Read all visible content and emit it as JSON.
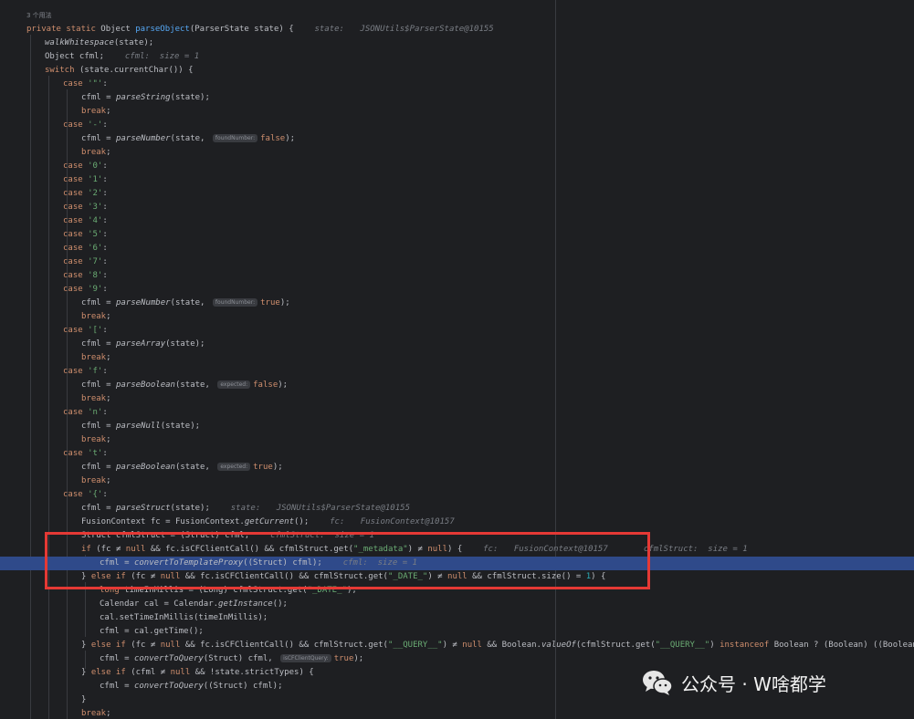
{
  "editor": {
    "usages_label": "3 个用法",
    "lines": [
      [
        [
          "private static ",
          "kw"
        ],
        [
          "Object ",
          ""
        ],
        [
          "parseObject",
          "fn"
        ],
        [
          "(ParserState state) {",
          ""
        ],
        [
          "  state: ",
          "inlay"
        ],
        [
          "JSONUtils$ParserState@10155",
          "inlay obj"
        ]
      ],
      [
        [
          "walkWhitespace",
          "it"
        ],
        [
          "(state);",
          ""
        ]
      ],
      [
        [
          "Object cfml;",
          ""
        ],
        [
          "  cfml:  size = 1",
          "inlay"
        ]
      ],
      [
        [
          "switch ",
          "kw"
        ],
        [
          "(state.currentChar()) {",
          ""
        ]
      ],
      [
        [
          "case ",
          "kw"
        ],
        [
          "'\"'",
          "str"
        ],
        [
          ":",
          ""
        ]
      ],
      [
        [
          "cfml = ",
          ""
        ],
        [
          "parseString",
          "it"
        ],
        [
          "(state);",
          ""
        ]
      ],
      [
        [
          "break",
          "kw"
        ],
        [
          ";",
          ""
        ]
      ],
      [
        [
          "case ",
          "kw"
        ],
        [
          "'-'",
          "str"
        ],
        [
          ":",
          ""
        ]
      ],
      [
        [
          "cfml = ",
          ""
        ],
        [
          "parseNumber",
          "it"
        ],
        [
          "(state, ",
          ""
        ],
        [
          "foundNumber:",
          "chip"
        ],
        [
          "false",
          "kw"
        ],
        [
          ");",
          ""
        ]
      ],
      [
        [
          "break",
          "kw"
        ],
        [
          ";",
          ""
        ]
      ],
      [
        [
          "case ",
          "kw"
        ],
        [
          "'0'",
          "str"
        ],
        [
          ":",
          ""
        ]
      ],
      [
        [
          "case ",
          "kw"
        ],
        [
          "'1'",
          "str"
        ],
        [
          ":",
          ""
        ]
      ],
      [
        [
          "case ",
          "kw"
        ],
        [
          "'2'",
          "str"
        ],
        [
          ":",
          ""
        ]
      ],
      [
        [
          "case ",
          "kw"
        ],
        [
          "'3'",
          "str"
        ],
        [
          ":",
          ""
        ]
      ],
      [
        [
          "case ",
          "kw"
        ],
        [
          "'4'",
          "str"
        ],
        [
          ":",
          ""
        ]
      ],
      [
        [
          "case ",
          "kw"
        ],
        [
          "'5'",
          "str"
        ],
        [
          ":",
          ""
        ]
      ],
      [
        [
          "case ",
          "kw"
        ],
        [
          "'6'",
          "str"
        ],
        [
          ":",
          ""
        ]
      ],
      [
        [
          "case ",
          "kw"
        ],
        [
          "'7'",
          "str"
        ],
        [
          ":",
          ""
        ]
      ],
      [
        [
          "case ",
          "kw"
        ],
        [
          "'8'",
          "str"
        ],
        [
          ":",
          ""
        ]
      ],
      [
        [
          "case ",
          "kw"
        ],
        [
          "'9'",
          "str"
        ],
        [
          ":",
          ""
        ]
      ],
      [
        [
          "cfml = ",
          ""
        ],
        [
          "parseNumber",
          "it"
        ],
        [
          "(state, ",
          ""
        ],
        [
          "foundNumber:",
          "chip"
        ],
        [
          "true",
          "kw"
        ],
        [
          ");",
          ""
        ]
      ],
      [
        [
          "break",
          "kw"
        ],
        [
          ";",
          ""
        ]
      ],
      [
        [
          "case ",
          "kw"
        ],
        [
          "'['",
          "str"
        ],
        [
          ":",
          ""
        ]
      ],
      [
        [
          "cfml = ",
          ""
        ],
        [
          "parseArray",
          "it"
        ],
        [
          "(state);",
          ""
        ]
      ],
      [
        [
          "break",
          "kw"
        ],
        [
          ";",
          ""
        ]
      ],
      [
        [
          "case ",
          "kw"
        ],
        [
          "'f'",
          "str"
        ],
        [
          ":",
          ""
        ]
      ],
      [
        [
          "cfml = ",
          ""
        ],
        [
          "parseBoolean",
          "it"
        ],
        [
          "(state, ",
          ""
        ],
        [
          "expected:",
          "chip"
        ],
        [
          "false",
          "kw"
        ],
        [
          ");",
          ""
        ]
      ],
      [
        [
          "break",
          "kw"
        ],
        [
          ";",
          ""
        ]
      ],
      [
        [
          "case ",
          "kw"
        ],
        [
          "'n'",
          "str"
        ],
        [
          ":",
          ""
        ]
      ],
      [
        [
          "cfml = ",
          ""
        ],
        [
          "parseNull",
          "it"
        ],
        [
          "(state);",
          ""
        ]
      ],
      [
        [
          "break",
          "kw"
        ],
        [
          ";",
          ""
        ]
      ],
      [
        [
          "case ",
          "kw"
        ],
        [
          "'t'",
          "str"
        ],
        [
          ":",
          ""
        ]
      ],
      [
        [
          "cfml = ",
          ""
        ],
        [
          "parseBoolean",
          "it"
        ],
        [
          "(state, ",
          ""
        ],
        [
          "expected:",
          "chip"
        ],
        [
          "true",
          "kw"
        ],
        [
          ");",
          ""
        ]
      ],
      [
        [
          "break",
          "kw"
        ],
        [
          ";",
          ""
        ]
      ],
      [
        [
          "case ",
          "kw"
        ],
        [
          "'{'",
          "str"
        ],
        [
          ":",
          ""
        ]
      ],
      [
        [
          "cfml = ",
          ""
        ],
        [
          "parseStruct",
          "it"
        ],
        [
          "(state);",
          ""
        ],
        [
          "  state: ",
          "inlay"
        ],
        [
          "JSONUtils$ParserState@10155",
          "inlay obj"
        ]
      ],
      [
        [
          "FusionContext fc = FusionContext.",
          ""
        ],
        [
          "getCurrent",
          "it"
        ],
        [
          "();",
          ""
        ],
        [
          "  fc: ",
          "inlay"
        ],
        [
          "FusionContext@10157",
          "inlay obj"
        ]
      ],
      [
        [
          "Struct cfmlStruct = (Struct) cfml;",
          ""
        ],
        [
          "  cfmlStruct:  size = 1",
          "inlay"
        ]
      ],
      [
        [
          "if ",
          "kw"
        ],
        [
          "(fc ≠ ",
          ""
        ],
        [
          "null ",
          "kw"
        ],
        [
          "&& fc.isCFClientCall() && cfmlStruct.get(",
          ""
        ],
        [
          "\"_metadata\"",
          "str"
        ],
        [
          ") ≠ ",
          ""
        ],
        [
          "null",
          "kw"
        ],
        [
          ") {",
          ""
        ],
        [
          "  fc: ",
          "inlay"
        ],
        [
          "FusionContext@10157",
          "inlay obj"
        ],
        [
          "     cfmlStruct:  size = 1",
          "inlay"
        ]
      ],
      [
        [
          "cfml = ",
          ""
        ],
        [
          "convertToTemplateProxy",
          "it"
        ],
        [
          "((Struct) cfml);",
          ""
        ],
        [
          "  cfml:  size = 1",
          "inlay"
        ]
      ],
      [
        [
          "} ",
          ""
        ],
        [
          "else if ",
          "kw"
        ],
        [
          "(fc ≠ ",
          ""
        ],
        [
          "null ",
          "kw"
        ],
        [
          "&& fc.isCFClientCall() && cfmlStruct.get(",
          ""
        ],
        [
          "\"_DATE_\"",
          "str"
        ],
        [
          ") ≠ ",
          ""
        ],
        [
          "null ",
          "kw"
        ],
        [
          "&& cfmlStruct.size() = ",
          ""
        ],
        [
          "1",
          "num"
        ],
        [
          ") {",
          ""
        ]
      ],
      [
        [
          "long ",
          "kw"
        ],
        [
          "timeInMillis = (Long) cfmlStruct.get(",
          ""
        ],
        [
          "\"_DATE_\"",
          "str"
        ],
        [
          ");",
          ""
        ]
      ],
      [
        [
          "Calendar cal = Calendar.",
          ""
        ],
        [
          "getInstance",
          "it"
        ],
        [
          "();",
          ""
        ]
      ],
      [
        [
          "cal.setTimeInMillis(timeInMillis);",
          ""
        ]
      ],
      [
        [
          "cfml = cal.getTime();",
          ""
        ]
      ],
      [
        [
          "} ",
          ""
        ],
        [
          "else if ",
          "kw"
        ],
        [
          "(fc ≠ ",
          ""
        ],
        [
          "null ",
          "kw"
        ],
        [
          "&& fc.isCFClientCall() && cfmlStruct.get(",
          ""
        ],
        [
          "\"__QUERY__\"",
          "str"
        ],
        [
          ") ≠ ",
          ""
        ],
        [
          "null ",
          "kw"
        ],
        [
          "&& Boolean.",
          ""
        ],
        [
          "valueOf",
          "it"
        ],
        [
          "(cfmlStruct.get(",
          ""
        ],
        [
          "\"__QUERY__\"",
          "str"
        ],
        [
          ") ",
          ""
        ],
        [
          "instanceof ",
          "kw"
        ],
        [
          "Boolean ? (Boolean) ((Boolean) cfmlStruct.get(",
          ""
        ],
        [
          "\"__QUERY__\"",
          "str"
        ],
        [
          ")) : ",
          ""
        ]
      ],
      [
        [
          "cfml = ",
          ""
        ],
        [
          "convertToQuery",
          "it"
        ],
        [
          "(Struct) cfml, ",
          ""
        ],
        [
          "isCFClientQuery:",
          "chip"
        ],
        [
          "true",
          "kw"
        ],
        [
          ");",
          ""
        ]
      ],
      [
        [
          "} ",
          ""
        ],
        [
          "else if ",
          "kw"
        ],
        [
          "(cfml ≠ ",
          ""
        ],
        [
          "null ",
          "kw"
        ],
        [
          "&& !state.strictTypes) {",
          ""
        ]
      ],
      [
        [
          "cfml = ",
          ""
        ],
        [
          "convertToQuery",
          "it"
        ],
        [
          "((Struct) cfml);",
          ""
        ]
      ],
      [
        [
          "}",
          ""
        ]
      ],
      [
        [
          "break",
          "kw"
        ],
        [
          ";",
          ""
        ]
      ]
    ]
  },
  "watermark": {
    "text": "公众号 · W啥都学",
    "icon": "wechat-icon"
  },
  "colors": {
    "background": "#1e1f22",
    "keyword": "#cf8e6d",
    "string": "#6aab73",
    "highlight": "#2f4a8a",
    "annotation_box": "#e53935"
  }
}
